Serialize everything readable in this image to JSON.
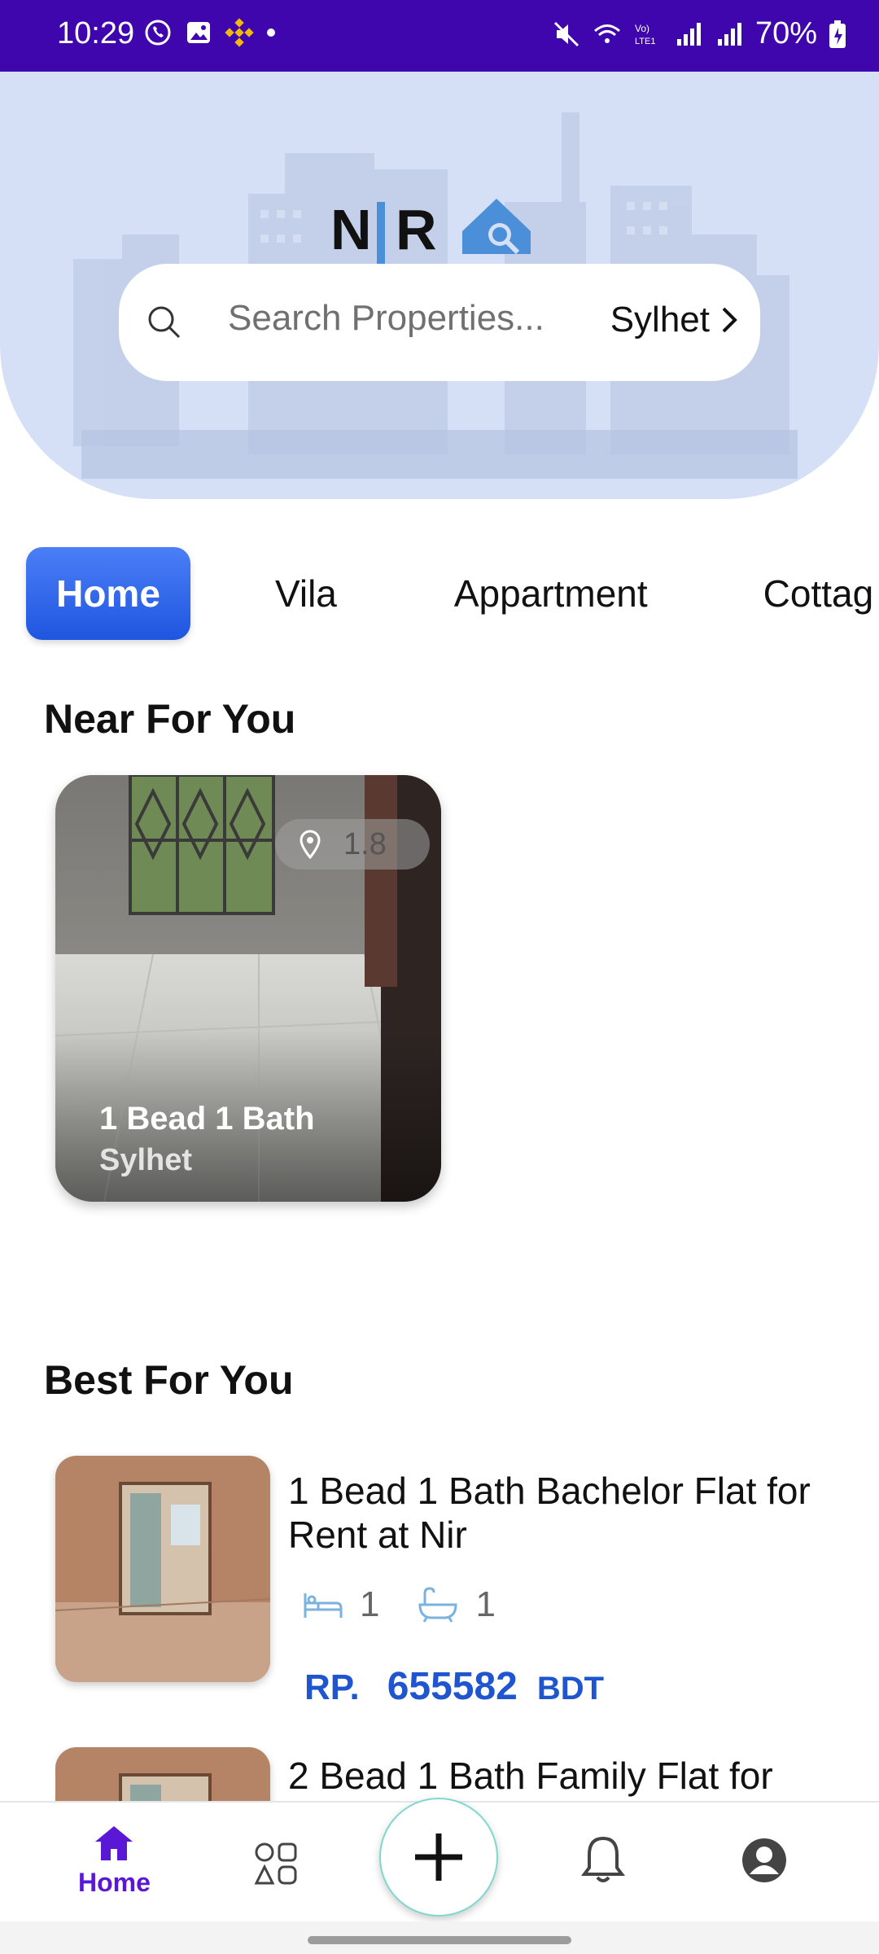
{
  "status_bar": {
    "time": "10:29",
    "battery": "70%",
    "bg_color": "#3f06ae"
  },
  "header": {
    "logo_text": "NIR",
    "search": {
      "placeholder": "Search Properties...",
      "city": "Sylhet"
    },
    "bg_color": "#d5dff6"
  },
  "tabs": [
    {
      "label": "Home",
      "active": true
    },
    {
      "label": "Vila"
    },
    {
      "label": "Appartment"
    },
    {
      "label": "Cottag"
    }
  ],
  "near": {
    "section_title": "Near For You",
    "card": {
      "distance": "1.8",
      "title": "1 Bead 1 Bath",
      "location": "Sylhet"
    }
  },
  "best": {
    "section_title": "Best For You",
    "items": [
      {
        "title": "1 Bead 1 Bath Bachelor Flat for Rent at Nir",
        "beds": "1",
        "baths": "1",
        "price_prefix": "RP.",
        "price": "655582",
        "currency": "BDT"
      },
      {
        "title": "2 Bead 1 Bath Family Flat for"
      }
    ]
  },
  "bottom_nav": {
    "home_label": "Home",
    "accent": "#5b17d6"
  }
}
